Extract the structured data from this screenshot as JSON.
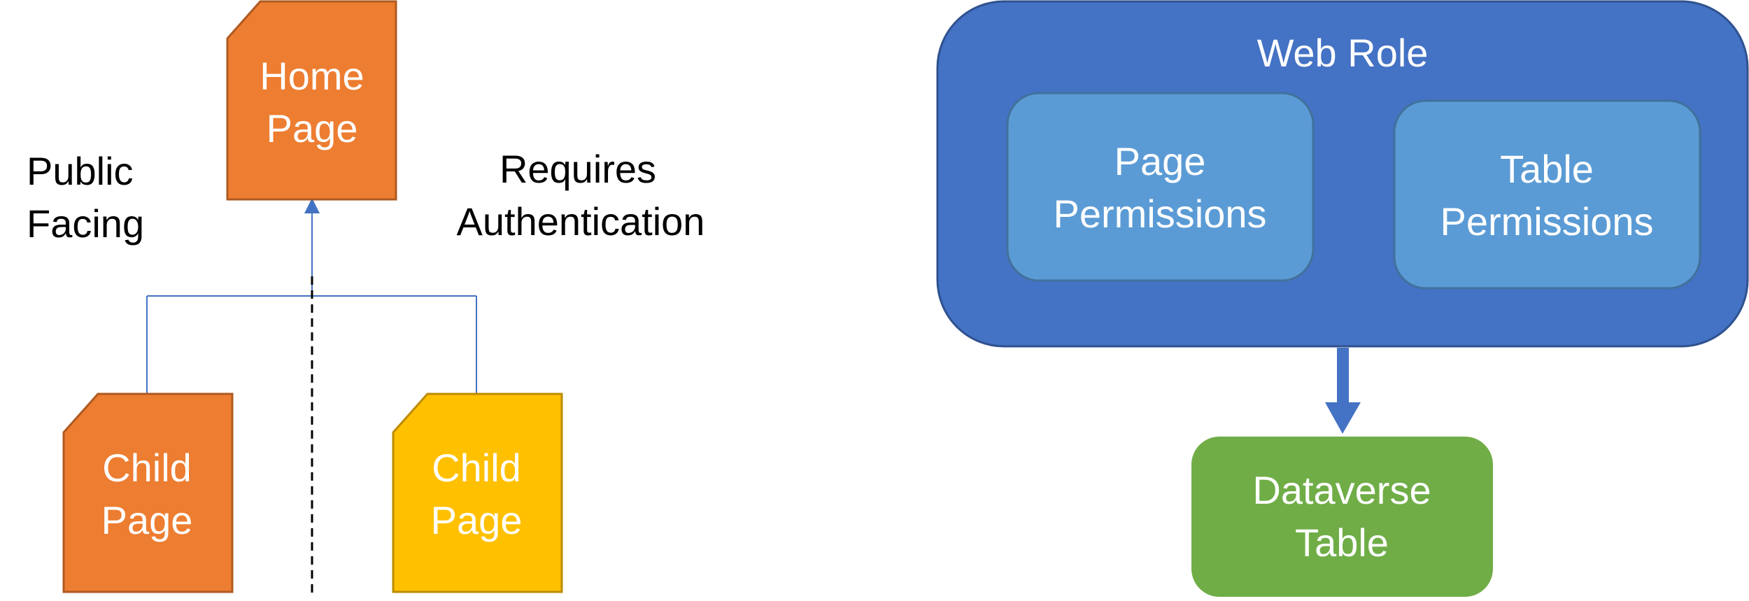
{
  "left_diagram": {
    "home_page": {
      "lines": [
        "Home",
        "Page"
      ],
      "fill": "#ED7D31"
    },
    "public_label": {
      "lines": [
        "Public",
        "Facing"
      ]
    },
    "auth_label": {
      "lines": [
        "Requires",
        "Authentication"
      ]
    },
    "child_public": {
      "lines": [
        "Child",
        "Page"
      ],
      "fill": "#ED7D31"
    },
    "child_auth": {
      "lines": [
        "Child",
        "Page"
      ],
      "fill": "#FFC000"
    },
    "connector_color": "#4472C4"
  },
  "right_diagram": {
    "web_role": {
      "title": "Web Role",
      "fill": "#4472C4"
    },
    "page_permissions": {
      "lines": [
        "Page",
        "Permissions"
      ],
      "fill": "#5B9BD5"
    },
    "table_permissions": {
      "lines": [
        "Table",
        "Permissions"
      ],
      "fill": "#5B9BD5"
    },
    "dataverse_table": {
      "lines": [
        "Dataverse",
        "Table"
      ],
      "fill": "#70AD47"
    }
  }
}
